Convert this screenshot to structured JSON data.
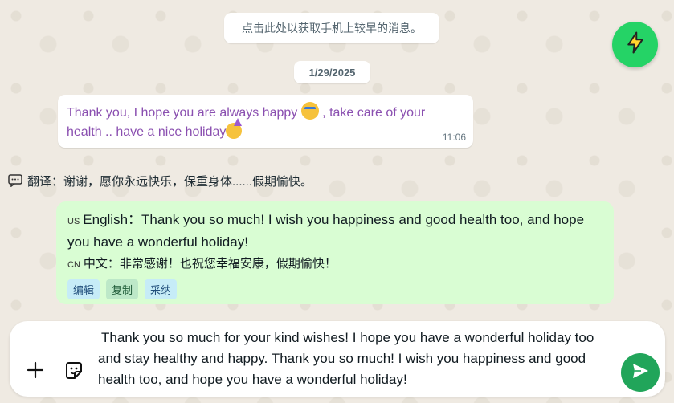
{
  "system_notice": "点击此处以获取手机上较早的消息。",
  "date_divider": "1/29/2025",
  "incoming": {
    "text_part1": "Thank you, I hope you are always happy ",
    "text_part2": " , take care of your health .. have a nice holiday",
    "time": "11:06"
  },
  "translation": {
    "text": "翻译：谢谢，愿你永远快乐，保重身体......假期愉快。"
  },
  "suggestion": {
    "en_flag": "US",
    "en_text": "English：Thank you so much! I wish you happiness and good health too, and hope you have a wonderful holiday!",
    "zh_flag": "CN",
    "zh_text": "中文：非常感谢！也祝您幸福安康，假期愉快！",
    "actions": [
      "编辑",
      "复制",
      "采纳"
    ]
  },
  "composer": {
    "input_value": "Thank you so much for your kind wishes! I hope you have a wonderful holiday too and stay healthy and happy. Thank you so much! I wish you happiness and good health too, and hope you have a wonderful holiday!"
  },
  "icons": {
    "fab": "lightning-icon",
    "translate": "chat-bubble-icon",
    "attach": "plus-icon",
    "sticker": "sticker-icon",
    "send": "send-icon"
  },
  "colors": {
    "accent": "#25d366",
    "send": "#21a55a",
    "suggestion_bg": "#d9fdd3",
    "incoming_text": "#8a4fb0"
  }
}
